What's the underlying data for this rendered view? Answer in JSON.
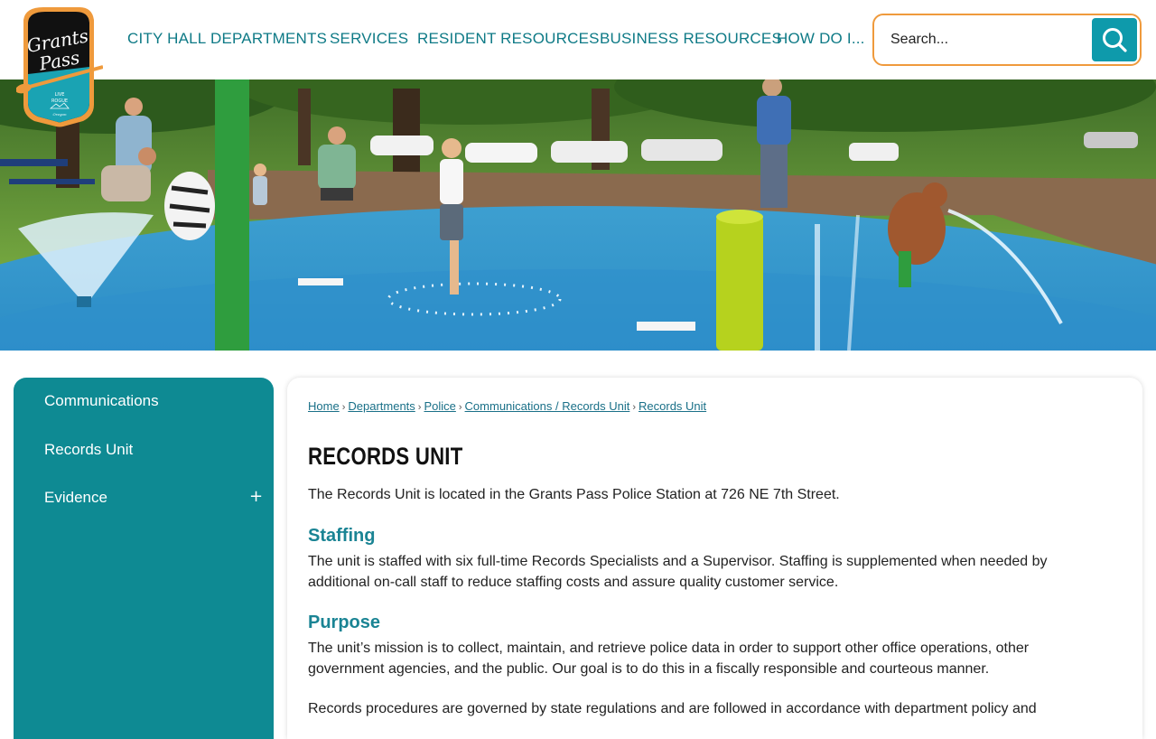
{
  "header": {
    "logo": {
      "line1": "Grants",
      "line2": "Pass",
      "tagline_top": "LIVE",
      "tagline_bottom": "ROGUE",
      "state": "Oregon"
    },
    "nav": [
      {
        "label": "CITY HALL"
      },
      {
        "label": "DEPARTMENTS"
      },
      {
        "label": "SERVICES"
      },
      {
        "label": "RESIDENT RESOURCES"
      },
      {
        "label": "BUSINESS RESOURCES"
      },
      {
        "label": "HOW DO I..."
      }
    ],
    "search": {
      "placeholder": "Search..."
    }
  },
  "colors": {
    "brand_teal": "#0e8a93",
    "nav_text": "#0e7a86",
    "search_border": "#ef9a3c",
    "search_button": "#0e9aab"
  },
  "sidebar": {
    "items": [
      {
        "label": "Communications"
      },
      {
        "label": "Records Unit"
      },
      {
        "label": "Evidence",
        "expand": "+"
      }
    ]
  },
  "breadcrumb": [
    {
      "label": "Home"
    },
    {
      "label": "Departments"
    },
    {
      "label": "Police"
    },
    {
      "label": "Communications / Records Unit"
    },
    {
      "label": "Records Unit"
    }
  ],
  "breadcrumb_separator": "›",
  "main": {
    "title": "RECORDS UNIT",
    "intro": "The Records Unit is located in the Grants Pass Police Station at 726 NE 7th Street.",
    "sections": [
      {
        "heading": "Staffing",
        "body": "The unit is staffed with six full-time Records Specialists and a Supervisor. Staffing is supplemented when needed by additional on-call staff to reduce staffing costs and assure quality customer service."
      },
      {
        "heading": "Purpose",
        "body": "The unit’s mission is to collect, maintain, and retrieve police data in order to support other office operations, other government agencies, and the public. Our goal is to do this in a fiscally responsible and courteous manner.",
        "body2": "Records procedures are governed by state regulations and are followed in accordance with department policy and"
      }
    ]
  }
}
